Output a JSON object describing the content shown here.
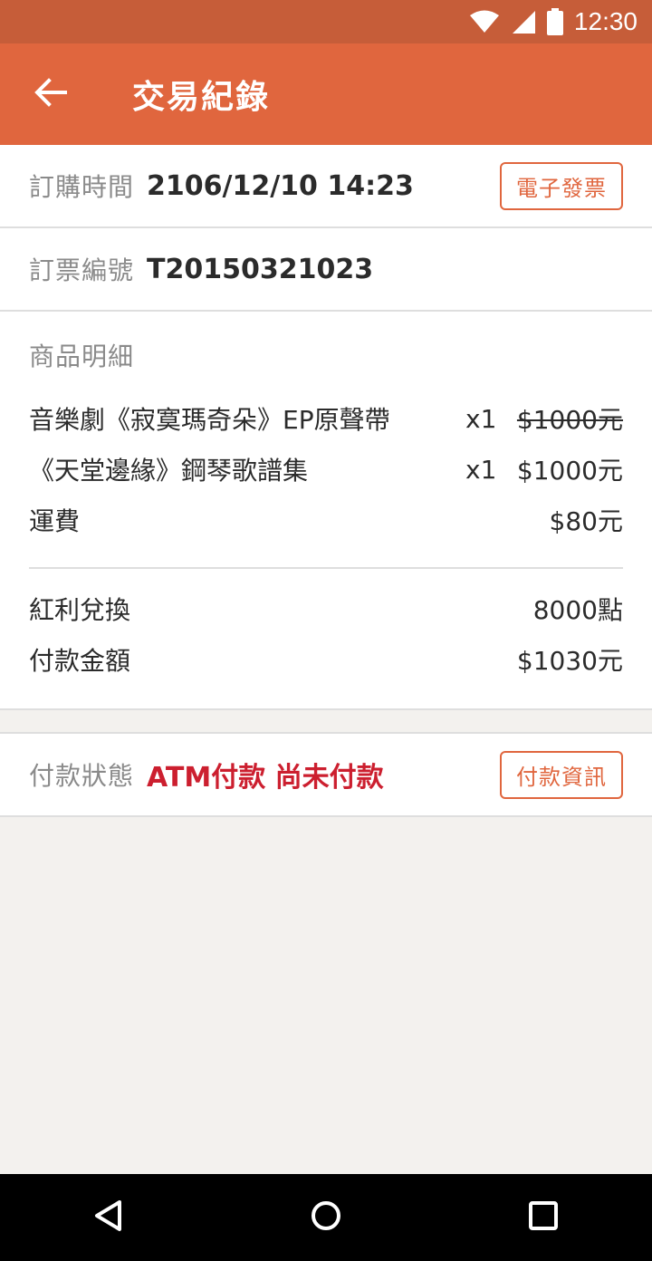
{
  "status_bar": {
    "time": "12:30",
    "icons": [
      "wifi-icon",
      "signal-icon",
      "battery-icon"
    ]
  },
  "app_bar": {
    "title": "交易紀錄",
    "back_icon": "arrow-left-icon"
  },
  "order_time": {
    "label": "訂購時間",
    "value": "2106/12/10 14:23",
    "button": "電子發票"
  },
  "order_number": {
    "label": "訂票編號",
    "value": "T20150321023"
  },
  "details": {
    "title": "商品明細",
    "items": [
      {
        "name": "音樂劇《寂寞瑪奇朵》EP原聲帶",
        "qty": "x1",
        "price": "$1000元",
        "struck": true
      },
      {
        "name": "《天堂邊緣》鋼琴歌譜集",
        "qty": "x1",
        "price": "$1000元",
        "struck": false
      },
      {
        "name": "運費",
        "qty": "",
        "price": "$80元",
        "struck": false
      }
    ],
    "bonus_label": "紅利兌換",
    "bonus_value": "8000點",
    "total_label": "付款金額",
    "total_value": "$1030元"
  },
  "payment": {
    "label": "付款狀態",
    "value": "ATM付款 尚未付款",
    "button": "付款資訊"
  },
  "colors": {
    "accent": "#e0663e",
    "status_bar": "#c65d39",
    "alert": "#cc1f2f",
    "background": "#f3f1ee"
  },
  "nav_bar": {
    "icons": [
      "back-triangle-icon",
      "home-circle-icon",
      "recents-square-icon"
    ]
  }
}
